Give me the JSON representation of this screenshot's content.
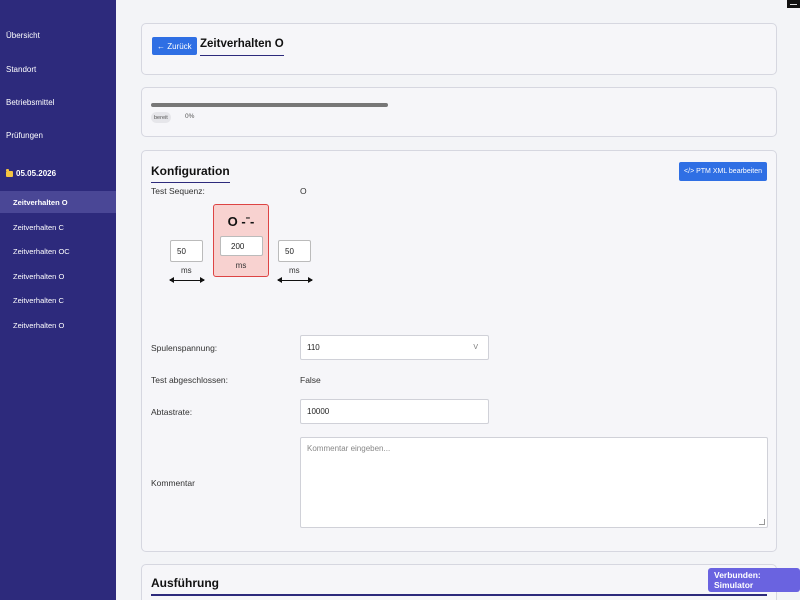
{
  "sidebar": {
    "nav": [
      "Übersicht",
      "Standort",
      "Betriebsmittel",
      "Prüfungen"
    ],
    "date": "05.05.2026",
    "tests": [
      "Zeitverhalten O",
      "Zeitverhalten C",
      "Zeitverhalten OC",
      "Zeitverhalten O",
      "Zeitverhalten C",
      "Zeitverhalten O"
    ],
    "active_index": 0
  },
  "header": {
    "back_label": "← Zurück",
    "title": "Zeitverhalten O"
  },
  "progress": {
    "fraction": 1.0,
    "status": "bereit",
    "percent": "0%"
  },
  "config": {
    "title": "Konfiguration",
    "xml_button": "</> PTM XML bearbeiten",
    "sequence_label": "Test Sequenz:",
    "sequence_value": "O",
    "pre_ms": "50",
    "op_symbol": "O -ˉ-",
    "op_ms": "200",
    "post_ms": "50",
    "unit": "ms",
    "coil_label": "Spulenspannung:",
    "coil_value": "110",
    "coil_unit": "V",
    "done_label": "Test abgeschlossen:",
    "done_value": "False",
    "rate_label": "Abtastrate:",
    "rate_value": "10000",
    "comment_label": "Kommentar",
    "comment_placeholder": "Kommentar eingeben..."
  },
  "execution": {
    "title": "Ausführung"
  },
  "connection": {
    "label": "Verbunden: Simulator"
  },
  "colors": {
    "sidebar": "#2d2a7c",
    "accent": "#2f6fe4",
    "badge": "#6a63e0",
    "op_fill": "#f8d2d0",
    "op_border": "#dd4444"
  }
}
